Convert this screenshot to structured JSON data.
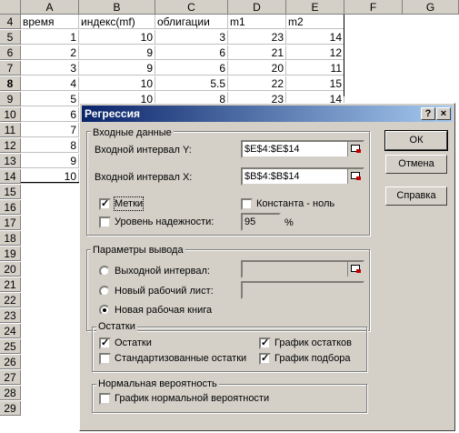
{
  "sheet": {
    "columns": [
      "A",
      "B",
      "C",
      "D",
      "E",
      "F",
      "G"
    ],
    "rows": [
      "4",
      "5",
      "6",
      "7",
      "8",
      "9",
      "10",
      "11",
      "12",
      "13",
      "14",
      "15",
      "16",
      "17",
      "18",
      "19",
      "20",
      "21",
      "22",
      "23",
      "24",
      "25",
      "26",
      "27",
      "28",
      "29"
    ],
    "headers": [
      "время",
      "индекс(mf)",
      "облигации",
      "m1",
      "m2"
    ],
    "data": [
      [
        "1",
        "10",
        "3",
        "23",
        "14"
      ],
      [
        "2",
        "9",
        "6",
        "21",
        "12"
      ],
      [
        "3",
        "9",
        "6",
        "20",
        "11"
      ],
      [
        "4",
        "10",
        "5.5",
        "22",
        "15"
      ],
      [
        "5",
        "10",
        "8",
        "23",
        "14"
      ],
      [
        "6",
        "",
        "",
        "",
        ""
      ],
      [
        "7",
        "",
        "",
        "",
        ""
      ],
      [
        "8",
        "",
        "",
        "",
        ""
      ],
      [
        "9",
        "",
        "",
        "",
        ""
      ],
      [
        "10",
        "",
        "",
        "",
        ""
      ]
    ]
  },
  "dialog": {
    "title": "Регрессия",
    "help_icon": "?",
    "close_icon": "×",
    "input_group": {
      "legend": "Входные данные",
      "y_label": "Входной интервал Y:",
      "y_value": "$E$4:$E$14",
      "x_label": "Входной интервал X:",
      "x_value": "$B$4:$B$14",
      "labels_label": "Метки",
      "constant_label": "Константа - ноль",
      "confidence_label": "Уровень надежности:",
      "confidence_value": "95",
      "percent": "%"
    },
    "output_group": {
      "legend": "Параметры вывода",
      "output_range_label": "Выходной интервал:",
      "new_sheet_label": "Новый рабочий лист:",
      "new_book_label": "Новая рабочая книга"
    },
    "residuals_group": {
      "legend": "Остатки",
      "residuals_label": "Остатки",
      "std_residuals_label": "Стандартизованные остатки",
      "residual_plots_label": "График остатков",
      "line_fit_label": "График подбора"
    },
    "normal_group": {
      "legend": "Нормальная вероятность",
      "normal_plot_label": "График нормальной вероятности"
    },
    "buttons": {
      "ok": "ОК",
      "cancel": "Отмена",
      "help": "Справка"
    }
  }
}
